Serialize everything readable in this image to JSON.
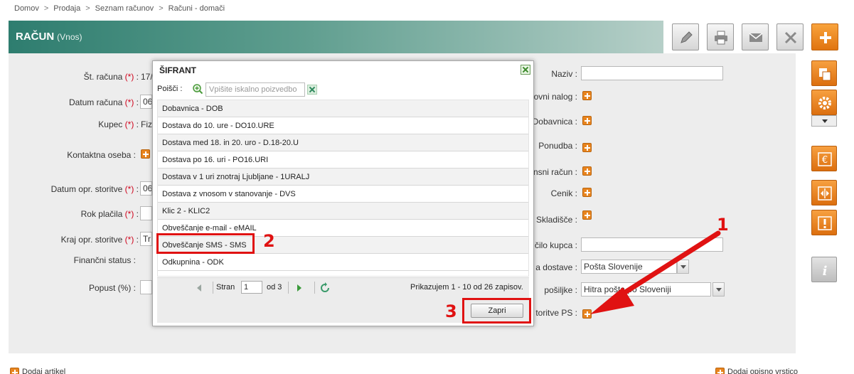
{
  "breadcrumb": [
    "Domov",
    "Prodaja",
    "Seznam računov",
    "Računi - domači"
  ],
  "breadcrumb_sep": ">",
  "header": {
    "title": "RAČUN",
    "subtitle": "(Vnos)"
  },
  "toolbar": {
    "icons": [
      "pencil-icon",
      "print-icon",
      "mail-icon",
      "close-icon",
      "plus-icon"
    ]
  },
  "form_left": {
    "st_racuna": {
      "label": "Št. računa",
      "req": "(*)",
      "value": "17/"
    },
    "datum_racuna": {
      "label": "Datum računa",
      "req": "(*)",
      "value": "06"
    },
    "kupec": {
      "label": "Kupec",
      "req": "(*)",
      "value": "Fiz"
    },
    "kontaktna_oseba": {
      "label": "Kontaktna oseba :"
    },
    "datum_opr": {
      "label": "Datum opr. storitve",
      "req": "(*)",
      "value": "06"
    },
    "rok_placila": {
      "label": "Rok plačila",
      "req": "(*)",
      "value": ""
    },
    "kraj_opr": {
      "label": "Kraj opr. storitve",
      "req": "(*)",
      "value": "Tr"
    },
    "financni_status": {
      "label": "Finančni status :"
    },
    "popust": {
      "label": "Popust (%) :",
      "value": ""
    }
  },
  "form_right": {
    "naziv": {
      "label": "Naziv :",
      "value": ""
    },
    "delovni_nalog": {
      "label": "ovni nalog :"
    },
    "dobavnica": {
      "label": "Dobavnica :"
    },
    "ponudba": {
      "label": "Ponudba :"
    },
    "avansni_racun": {
      "label": "nsni račun :"
    },
    "cenik": {
      "label": "Cenik :"
    },
    "skladisce": {
      "label": "Skladišče :"
    },
    "narocilo_kupca": {
      "label": "čilo kupca :",
      "value": ""
    },
    "nacin_dostave": {
      "label": "a dostave :",
      "value": "Pošta Slovenije"
    },
    "vrsta_posiljke": {
      "label": "pošiljke :",
      "value": "Hitra pošta po Sloveniji"
    },
    "storitve_ps": {
      "label": "toritve PS :"
    }
  },
  "bottom": {
    "dodaj_artikel": "Dodaj artikel",
    "dodaj_opisno": "Dodaj opisno vrstico"
  },
  "modal": {
    "title": "ŠIFRANT",
    "search_label": "Poišči :",
    "search_placeholder": "Vpišite iskalno poizvedbo",
    "items": [
      "Dobavnica - DOB",
      "Dostava do 10. ure - DO10.URE",
      "Dostava med 18. in 20. uro - D.18-20.U",
      "Dostava po 16. uri - PO16.URI",
      "Dostava v 1 uri znotraj Ljubljane - 1URALJ",
      "Dostava z vnosom v stanovanje - DVS",
      "Klic 2 - KLIC2",
      "Obveščanje e-mail - eMAIL",
      "Obveščanje SMS - SMS",
      "Odkupnina - ODK"
    ],
    "pager": {
      "page_label": "Stran",
      "page_value": "1",
      "of_label": "od 3",
      "summary": "Prikazujem 1 - 10 od 26 zapisov."
    },
    "close_button": "Zapri"
  },
  "annotations": {
    "n1": "1",
    "n2": "2",
    "n3": "3"
  },
  "colors": {
    "accent_orange": "#e8841e",
    "header_green": "#2e7d6f",
    "annotation_red": "#e01212"
  }
}
